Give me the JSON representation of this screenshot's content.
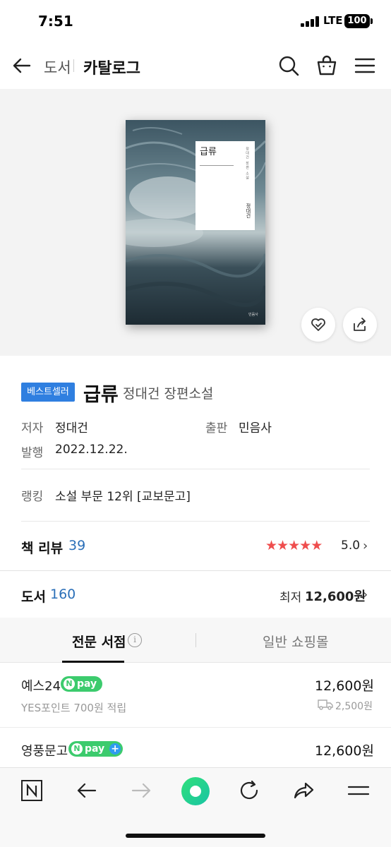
{
  "status_bar": {
    "time": "7:51",
    "network": "LTE",
    "battery": "100"
  },
  "header": {
    "breadcrumb": "도서",
    "title": "카탈로그",
    "icons": [
      "back-arrow-icon",
      "search-icon",
      "shopping-bag-icon",
      "menu-icon"
    ]
  },
  "book": {
    "cover_title": "급류",
    "cover_subtitle": "정대건 장편 소설",
    "cover_author": "정대건",
    "cover_publisher": "민음사",
    "badge": "베스트셀러",
    "title": "급류",
    "subtitle": "정대건 장편소설",
    "author_label": "저자",
    "author": "정대건",
    "publisher_label": "출판",
    "publisher": "민음사",
    "date_label": "발행",
    "date": "2022.12.22.",
    "ranking_label": "랭킹",
    "ranking": "소설 부문 12위 [교보문고]"
  },
  "review": {
    "label": "책 리뷰",
    "count": "39",
    "rating": "5.0",
    "stars": 5
  },
  "books": {
    "label": "도서",
    "count": "160",
    "lowest_label": "최저",
    "lowest_price": "12,600원"
  },
  "tabs": {
    "active": "전문 서점",
    "inactive": "일반 쇼핑몰"
  },
  "stores": [
    {
      "name": "예스24",
      "npay": "pay",
      "price": "12,600원",
      "points": "YES포인트 700원 적립",
      "shipping": "2,500원"
    },
    {
      "name": "영풍문고",
      "npay": "pay",
      "price": "12,600원"
    }
  ],
  "colors": {
    "accent": "#2f7fe0",
    "link": "#2a6fb8",
    "star": "#ef4d4d",
    "npay": "#3ccb6d"
  }
}
